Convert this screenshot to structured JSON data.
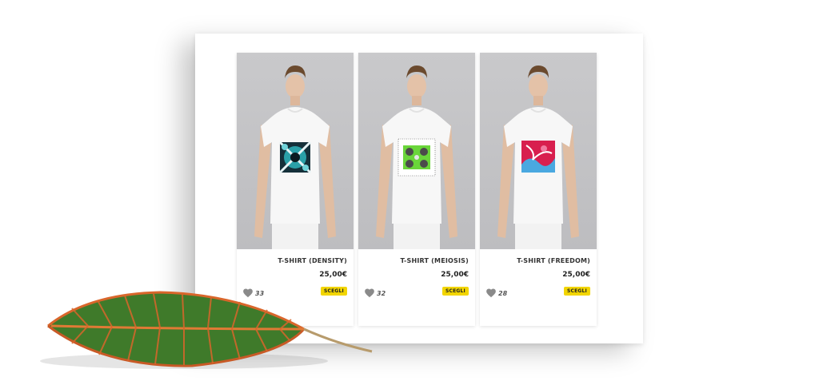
{
  "products": [
    {
      "title": "T-SHIRT (DENSITY)",
      "price": "25,00€",
      "likes": "33",
      "button": "SCEGLI",
      "print": "density"
    },
    {
      "title": "T-SHIRT (MEIOSIS)",
      "price": "25,00€",
      "likes": "32",
      "button": "SCEGLI",
      "print": "meiosis"
    },
    {
      "title": "T-SHIRT (FREEDOM)",
      "price": "25,00€",
      "likes": "28",
      "button": "SCEGLI",
      "print": "freedom"
    }
  ],
  "colors": {
    "accent": "#f2d500",
    "heart": "#8a8a8a",
    "leaf_green": "#3f7a2a",
    "leaf_vein": "#d9662b"
  },
  "icons": {
    "like": "heart-icon"
  }
}
